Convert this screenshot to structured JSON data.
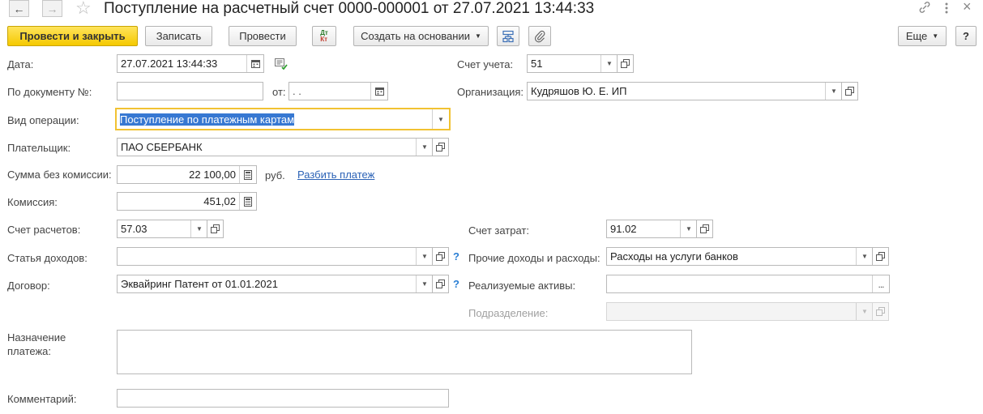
{
  "window": {
    "title": "Поступление на расчетный счет 0000-000001 от 27.07.2021 13:44:33"
  },
  "toolbar": {
    "post_close": "Провести и закрыть",
    "save": "Записать",
    "post": "Провести",
    "dtkt_top": "Дт",
    "dtkt_bottom": "Кт",
    "create_based": "Создать на основании",
    "more": "Еще",
    "help": "?"
  },
  "form": {
    "date_label": "Дата:",
    "date_value": "27.07.2021 13:44:33",
    "doc_num_label": "По документу №:",
    "doc_num_value": "",
    "from_label": "от:",
    "from_value": " .  .",
    "op_type_label": "Вид операции:",
    "op_type_value": "Поступление по платежным картам",
    "payer_label": "Плательщик:",
    "payer_value": "ПАО СБЕРБАНК",
    "amount_label": "Сумма без комиссии:",
    "amount_value": "22 100,00",
    "currency": "руб.",
    "split_link": "Разбить платеж",
    "commission_label": "Комиссия:",
    "commission_value": "451,02",
    "settle_acc_label": "Счет расчетов:",
    "settle_acc_value": "57.03",
    "income_item_label": "Статья доходов:",
    "income_item_value": "",
    "contract_label": "Договор:",
    "contract_value": "Эквайринг Патент от 01.01.2021",
    "purpose_label": "Назначение\nплатежа:",
    "purpose_value": "",
    "comment_label": "Комментарий:",
    "comment_value": "",
    "account_label": "Счет учета:",
    "account_value": "51",
    "org_label": "Организация:",
    "org_value": "Кудряшов Ю. Е. ИП",
    "cost_acc_label": "Счет затрат:",
    "cost_acc_value": "91.02",
    "other_ie_label": "Прочие доходы и расходы:",
    "other_ie_value": "Расходы на услуги банков",
    "assets_label": "Реализуемые активы:",
    "assets_value": "",
    "division_label": "Подразделение:",
    "division_value": "",
    "help_mark": "?"
  }
}
